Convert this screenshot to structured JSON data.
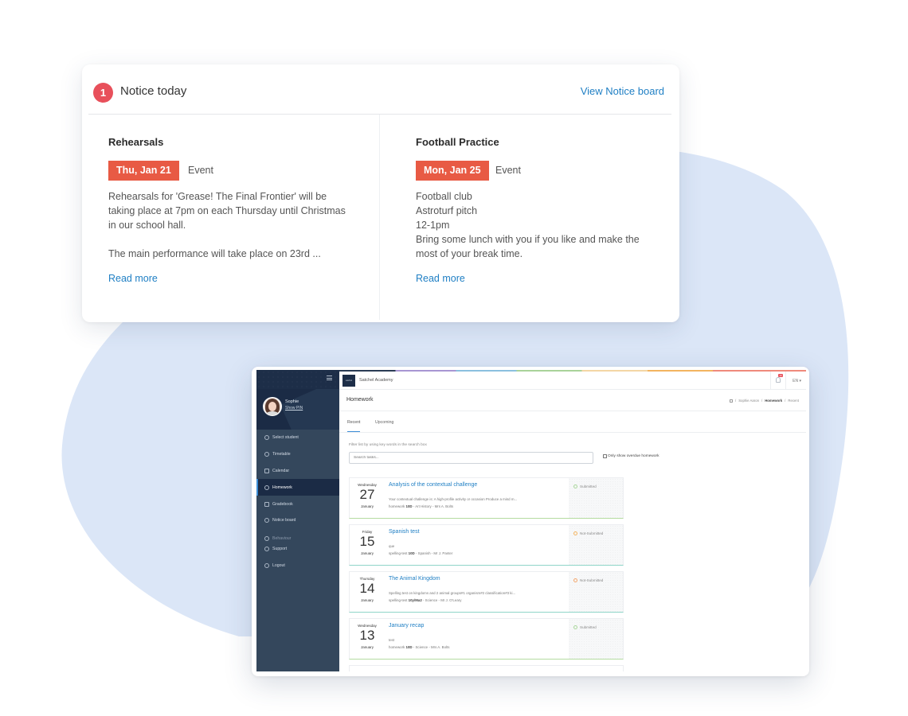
{
  "colors": {
    "accent_blue": "#1f7fc4",
    "badge_red": "#e8505b",
    "date_red": "#e85a44",
    "sidebar_dark": "#1b2b45",
    "sidebar": "#34475c",
    "blob": "#dbe6f7"
  },
  "notice_card": {
    "count": "1",
    "title": "Notice today",
    "view_link": "View Notice board",
    "notices": [
      {
        "title": "Rehearsals",
        "date": "Thu, Jan 21",
        "type": "Event",
        "body": [
          "Rehearsals for 'Grease! The Final Frontier' will be taking place at 7pm on each Thursday until Christmas in our school hall.",
          "",
          "The main performance will take place on 23rd ..."
        ],
        "read_more": "Read more"
      },
      {
        "title": "Football Practice",
        "date": "Mon, Jan 25",
        "type": "Event",
        "body": [
          "Football club",
          "Astroturf pitch",
          "12-1pm",
          "Bring some lunch with you if you like and make the most of your break time."
        ],
        "read_more": "Read more"
      }
    ]
  },
  "app": {
    "logo_text": "satchel",
    "school_name": "Satchel Academy",
    "notification_count": "10",
    "language": "EN ▾",
    "profile": {
      "name": "Sophie",
      "pin_link": "Show PIN"
    },
    "nav": [
      {
        "label": "Select student",
        "icon": "gauge-icon"
      },
      {
        "label": "Timetable",
        "icon": "bell-icon"
      },
      {
        "label": "Calendar",
        "icon": "calendar-icon"
      },
      {
        "label": "Homework",
        "icon": "user-icon",
        "active": true
      },
      {
        "label": "Gradebook",
        "icon": "book-icon"
      },
      {
        "label": "Notice board",
        "icon": "pin-icon"
      },
      {
        "label": "Behaviour",
        "icon": "behaviour-icon"
      },
      {
        "label": "Support",
        "icon": "lifebuoy-icon"
      },
      {
        "label": "Logout",
        "icon": "power-icon"
      }
    ],
    "page_title": "Homework",
    "breadcrumb": [
      "Sophie Aaron",
      "Homework",
      "Recent"
    ],
    "tabs": [
      {
        "label": "Recent",
        "active": true
      },
      {
        "label": "Upcoming",
        "active": false
      }
    ],
    "filter_label": "Filter list by using key words in the search box",
    "search": {
      "placeholder": "Search tasks...",
      "value": ""
    },
    "overdue_checkbox": {
      "label": "Only show overdue homework",
      "checked": false
    },
    "homework": [
      {
        "weekday": "Wednesday",
        "day": "27",
        "month": "January",
        "title": "Analysis of the contextual challenge",
        "description": "Your contextual challenge is: A high-profile activity or occasion Produce a mind m...",
        "type": "homework",
        "class": "10D",
        "subject": "Art History",
        "teacher": "Mrs A. Bolts",
        "status": "Submitted"
      },
      {
        "weekday": "Friday",
        "day": "15",
        "month": "January",
        "title": "Spanish test",
        "description": "que",
        "type": "spelling-test",
        "class": "10D",
        "subject": "Spanish",
        "teacher": "Mr J. Panter",
        "status": "Not-Submitted"
      },
      {
        "weekday": "Thursday",
        "day": "14",
        "month": "January",
        "title": "The Animal Kingdom",
        "description": "Spelling test on kingdoms and 2 animal groups#1 organism#2 classification#3 ki...",
        "type": "spelling-test",
        "class": "10y/Ma2",
        "subject": "Science",
        "teacher": "Mr J. O'Leary",
        "status": "Not-Submitted"
      },
      {
        "weekday": "Wednesday",
        "day": "13",
        "month": "January",
        "title": "January recap",
        "description": "test",
        "type": "homework",
        "class": "10D",
        "subject": "Science",
        "teacher": "Mrs A. Bolts",
        "status": "Submitted"
      }
    ]
  }
}
